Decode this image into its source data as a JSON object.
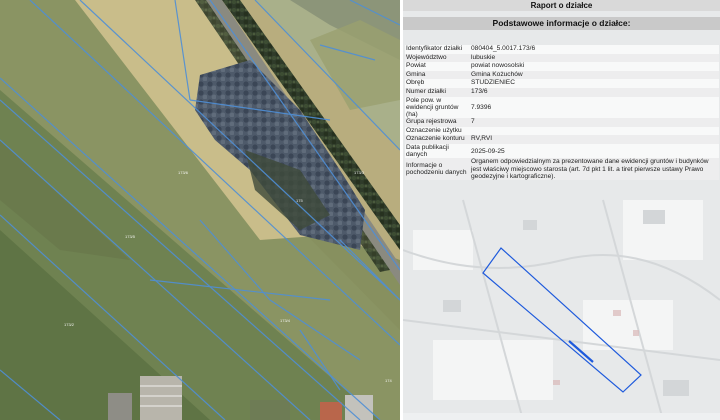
{
  "report": {
    "title": "Raport o działce",
    "section_title": "Podstawowe informacje o działce:",
    "rows": [
      {
        "label": "Identyfikator działki",
        "value": "080404_5.0017.173/6"
      },
      {
        "label": "Województwo",
        "value": "lubuskie"
      },
      {
        "label": "Powiat",
        "value": "powiat nowosolski"
      },
      {
        "label": "Gmina",
        "value": "Gmina Kożuchów"
      },
      {
        "label": "Obręb",
        "value": "STUDZIENIEC"
      },
      {
        "label": "Numer działki",
        "value": "173/6"
      },
      {
        "label": "Pole pow. w ewidencji gruntów (ha)",
        "value": "7.9396"
      },
      {
        "label": "Grupa rejestrowa",
        "value": "7"
      },
      {
        "label": "Oznaczenie użytku",
        "value": ""
      },
      {
        "label": "Oznaczenie konturu",
        "value": "RV,RVI"
      },
      {
        "label": "Data publikacji danych",
        "value": "2025-09-25"
      },
      {
        "label": "Informacje o pochodzeniu danych",
        "value": "Organem odpowiedzialnym za prezentowane dane ewidencji gruntów i budynków jest właściwy miejscowo starosta (art. 7d pkt 1 lit. a tiret pierwsze ustawy Prawo geodezyjne i kartograficzne)."
      }
    ]
  },
  "map": {
    "parcel_labels": [
      "173/6",
      "173/5",
      "173/2",
      "173/4",
      "173/3",
      "174",
      "175"
    ]
  },
  "colors": {
    "parcel_outline": "#1e5adc",
    "boundary_lines": "#4f8fd6"
  }
}
